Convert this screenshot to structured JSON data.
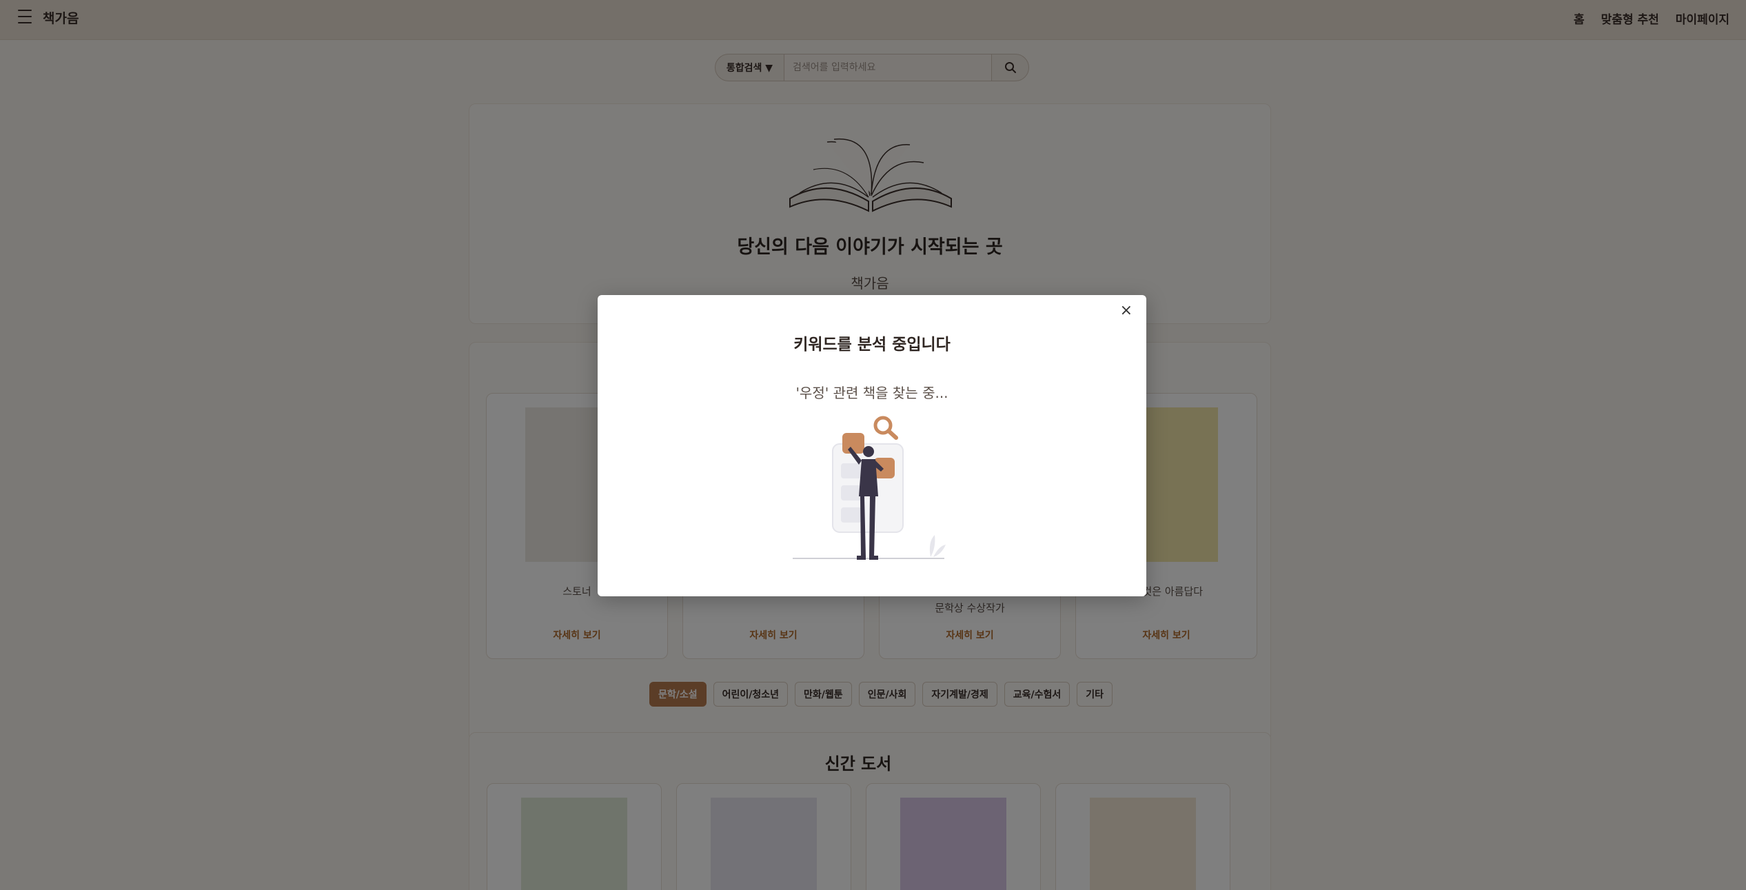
{
  "header": {
    "logo": "책가음",
    "nav": [
      "홈",
      "맞춤형 추천",
      "마이페이지"
    ]
  },
  "search": {
    "scope": "통합검색 ▼",
    "placeholder": "검색어를 입력하세요"
  },
  "hero": {
    "title": "당신의 다음 이야기가 시작되는 곳",
    "subtitle": "책가음"
  },
  "recommendations": {
    "cards": [
      {
        "title": "스토너",
        "subtitle": "",
        "more": "자세히 보기"
      },
      {
        "title": "",
        "subtitle": "",
        "more": "자세히 보기"
      },
      {
        "title": "",
        "subtitle": "문학상 수상작가",
        "more": "자세히 보기"
      },
      {
        "title": "는 것은 아름답다",
        "subtitle": "",
        "more": "자세히 보기"
      }
    ]
  },
  "categories": [
    "문학/소설",
    "어린이/청소년",
    "만화/웹툰",
    "인문/사회",
    "자기계발/경제",
    "교육/수험서",
    "기타"
  ],
  "new_books": {
    "title": "신간 도서"
  },
  "modal": {
    "close": "×",
    "title": "키워드를 분석 중입니다",
    "message": "'우정' 관련 책을 찾는 중..."
  },
  "colors": {
    "accent": "#b06a2b",
    "header_bg": "#e9dfd3",
    "chip_active": "#b77b4f"
  }
}
